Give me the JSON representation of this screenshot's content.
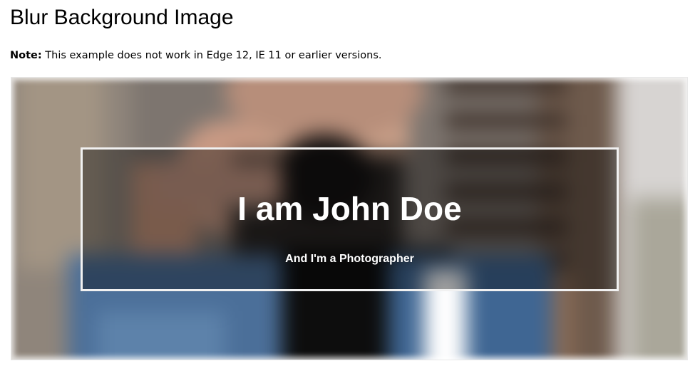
{
  "page": {
    "heading": "Blur Background Image",
    "note": {
      "label": "Note:",
      "text": " This example does not work in Edge 12, IE 11 or earlier versions."
    }
  },
  "hero": {
    "title": "I am John Doe",
    "subtitle": "And I'm a Photographer",
    "image_description_icon": "blurred-photo-image"
  },
  "colors": {
    "text": "#000000",
    "hero_text": "#ffffff",
    "frame_border": "#f1f1f1"
  }
}
